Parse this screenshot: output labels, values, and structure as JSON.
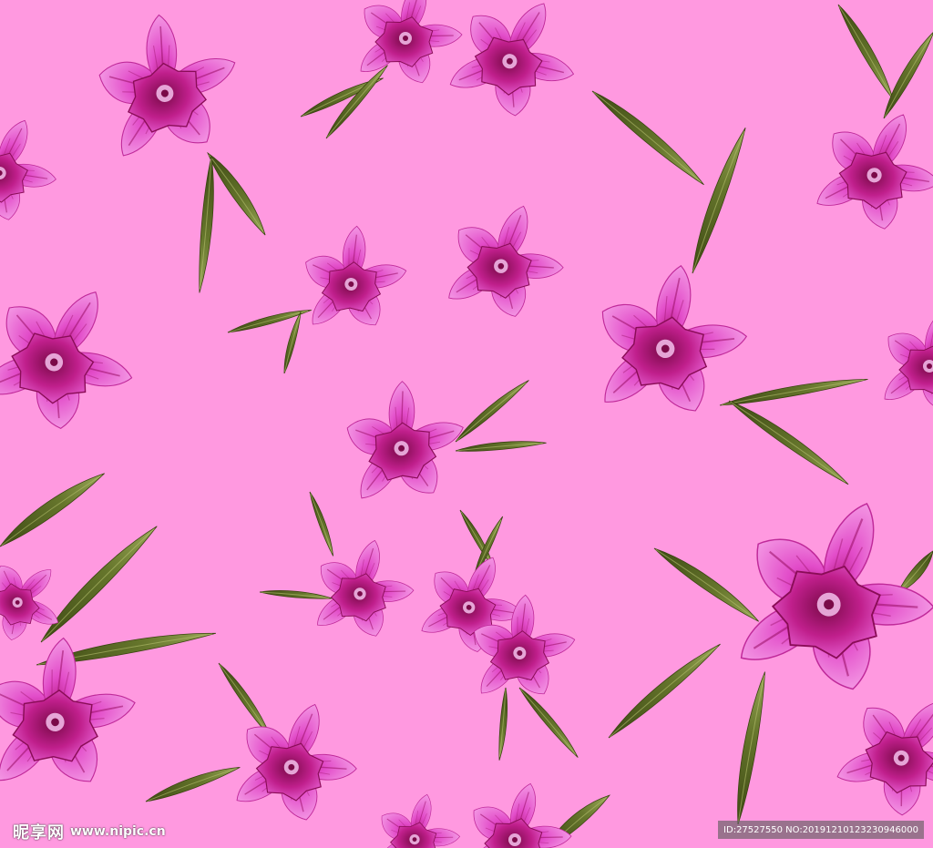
{
  "image": {
    "description_colors": {
      "background": "#ff99e0",
      "petal_light": "#f07ce0",
      "petal_mid": "#e048c8",
      "petal_dark": "#a8106a",
      "petal_deep": "#7a0a48",
      "leaf_dark": "#4f5a1e",
      "leaf_light": "#8a9a4a"
    }
  },
  "watermark": {
    "brand": "昵享网",
    "url": "www.nipic.cn",
    "id_text": "ID:27527550 NO:20191210123230946000"
  }
}
